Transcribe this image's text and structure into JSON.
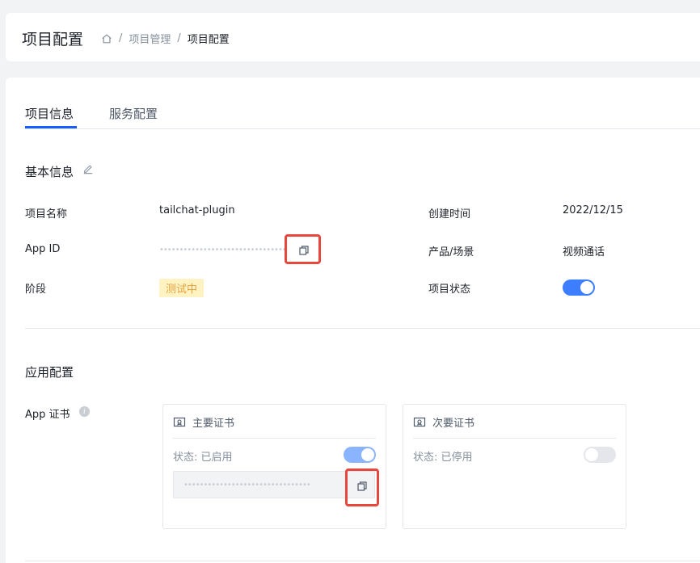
{
  "header": {
    "title": "项目配置",
    "breadcrumb": [
      "项目管理",
      "项目配置"
    ],
    "separator": "/"
  },
  "tabs": [
    {
      "label": "项目信息",
      "active": true
    },
    {
      "label": "服务配置",
      "active": false
    }
  ],
  "basic_info": {
    "title": "基本信息",
    "fields": {
      "project_name_label": "项目名称",
      "project_name_value": "tailchat-plugin",
      "app_id_label": "App ID",
      "app_id_masked": "••••••••••••••••••••••••••••••••",
      "stage_label": "阶段",
      "stage_value": "测试中",
      "created_label": "创建时间",
      "created_value": "2022/12/15",
      "scene_label": "产品/场景",
      "scene_value": "视频通话",
      "status_label": "项目状态",
      "status_on": true
    }
  },
  "app_config": {
    "title": "应用配置",
    "cert_label": "App 证书",
    "primary": {
      "title": "主要证书",
      "status": "状态: 已启用",
      "enabled": true,
      "key_masked": "••••••••••••••••••••••••••••••••"
    },
    "secondary": {
      "title": "次要证书",
      "status": "状态: 已停用",
      "enabled": false
    }
  },
  "colors": {
    "accent": "#165dff",
    "switch_on": "#3c7eff",
    "highlight": "#e8473e",
    "tag_bg": "#fff3c4",
    "tag_text": "#e6a23c"
  }
}
